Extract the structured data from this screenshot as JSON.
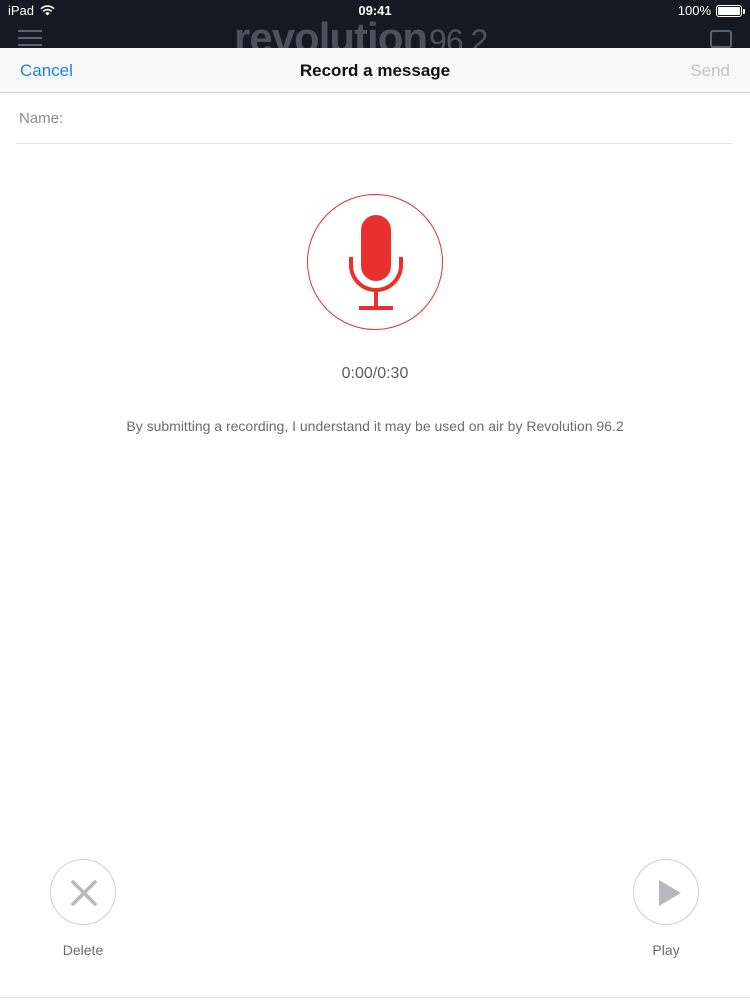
{
  "status_bar": {
    "device": "iPad",
    "time": "09:41",
    "battery": "100%"
  },
  "background_app": {
    "logo_main": "revolution",
    "logo_number": "96.2"
  },
  "nav": {
    "cancel_label": "Cancel",
    "title": "Record a message",
    "send_label": "Send"
  },
  "form": {
    "name_label": "Name:",
    "name_value": ""
  },
  "recorder": {
    "timer": "0:00/0:30",
    "disclaimer": "By submitting a recording, I understand it may be used on air by Revolution 96.2"
  },
  "controls": {
    "delete_label": "Delete",
    "play_label": "Play"
  },
  "colors": {
    "accent": "#1a82e6",
    "record": "#e8302f",
    "disabled": "#c4c4c8"
  },
  "icons": {
    "record": "microphone-icon",
    "delete": "close-icon",
    "play": "play-icon"
  }
}
